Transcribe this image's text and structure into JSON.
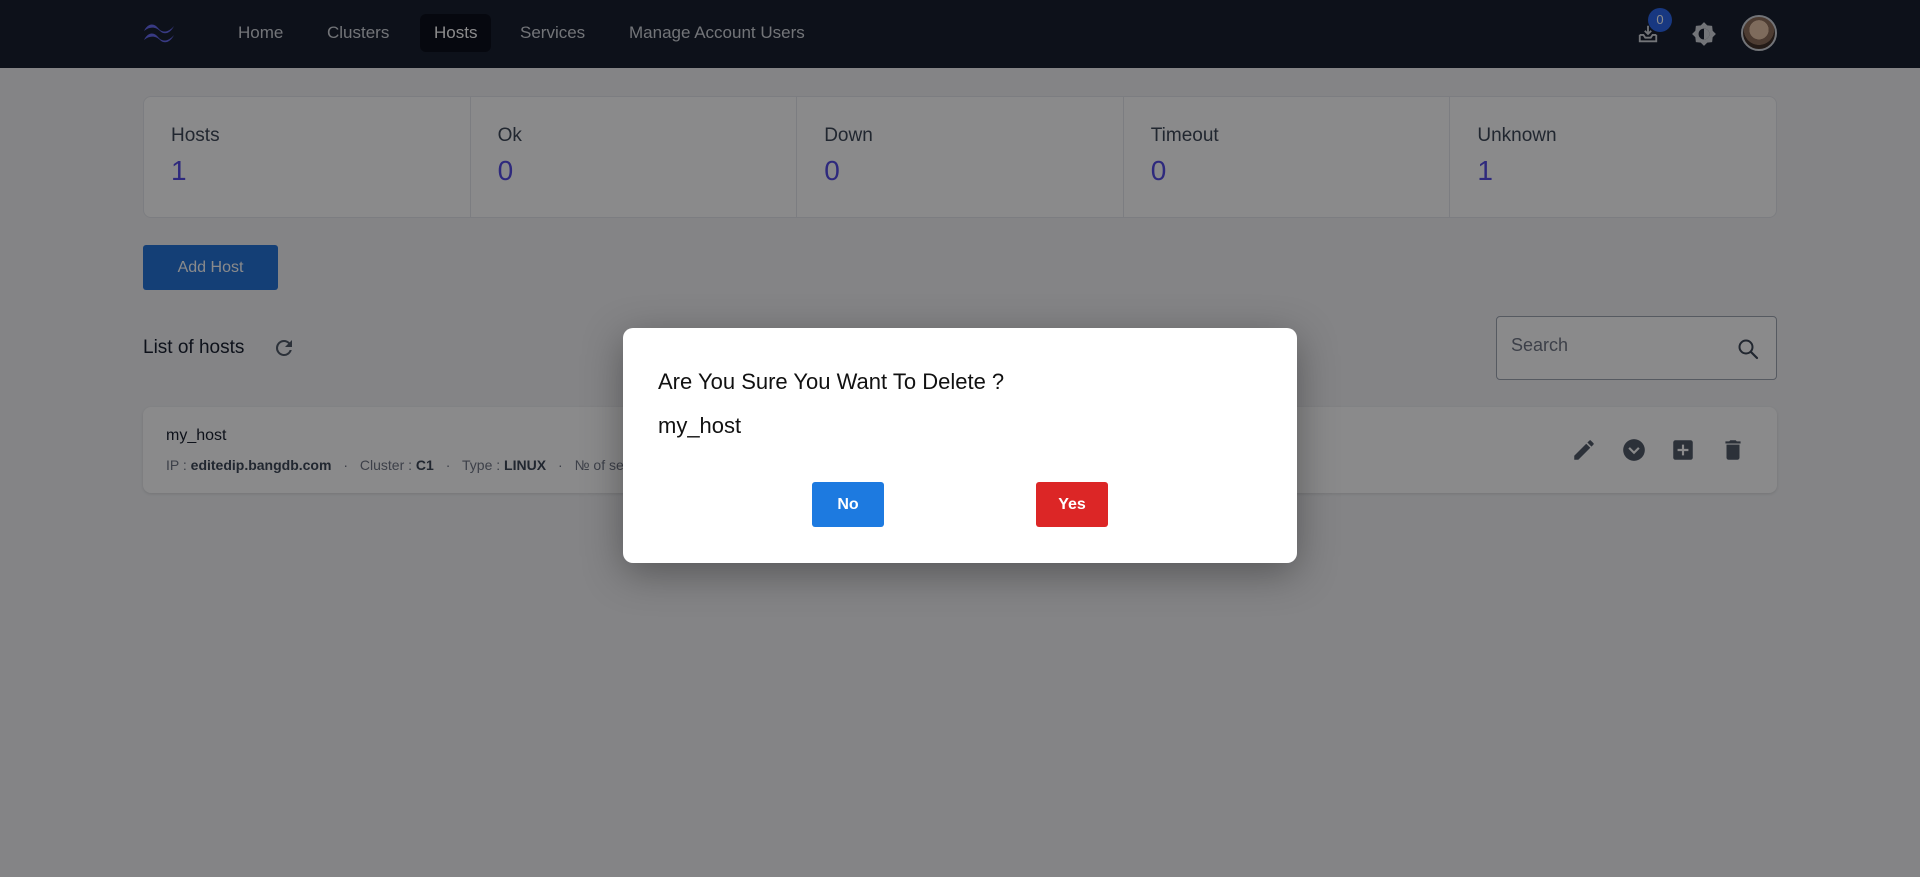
{
  "nav": {
    "links": [
      {
        "label": "Home",
        "active": false
      },
      {
        "label": "Clusters",
        "active": false
      },
      {
        "label": "Hosts",
        "active": true
      },
      {
        "label": "Services",
        "active": false
      },
      {
        "label": "Manage Account Users",
        "active": false
      }
    ],
    "notification_count": "0",
    "icons": [
      "tailwind-logo",
      "inbox-download-icon",
      "brightness-icon",
      "avatar"
    ]
  },
  "stats": [
    {
      "label": "Hosts",
      "value": "1"
    },
    {
      "label": "Ok",
      "value": "0"
    },
    {
      "label": "Down",
      "value": "0"
    },
    {
      "label": "Timeout",
      "value": "0"
    },
    {
      "label": "Unknown",
      "value": "1"
    }
  ],
  "actions": {
    "add_host_label": "Add Host"
  },
  "list": {
    "title": "List of hosts",
    "search_placeholder": "Search",
    "hosts": [
      {
        "name": "my_host",
        "ip_label": "IP :",
        "ip": "editedip.bangdb.com",
        "cluster_label": "Cluster :",
        "cluster": "C1",
        "type_label": "Type :",
        "type": "LINUX",
        "services_label": "№ of services"
      }
    ]
  },
  "modal": {
    "title": "Are You Sure You Want To Delete ?",
    "item": "my_host",
    "no_label": "No",
    "yes_label": "Yes"
  },
  "colors": {
    "nav_bg": "#111827",
    "accent": "#4f46e5",
    "primary_button": "#1d6fd6",
    "danger_button": "#dc2626"
  }
}
